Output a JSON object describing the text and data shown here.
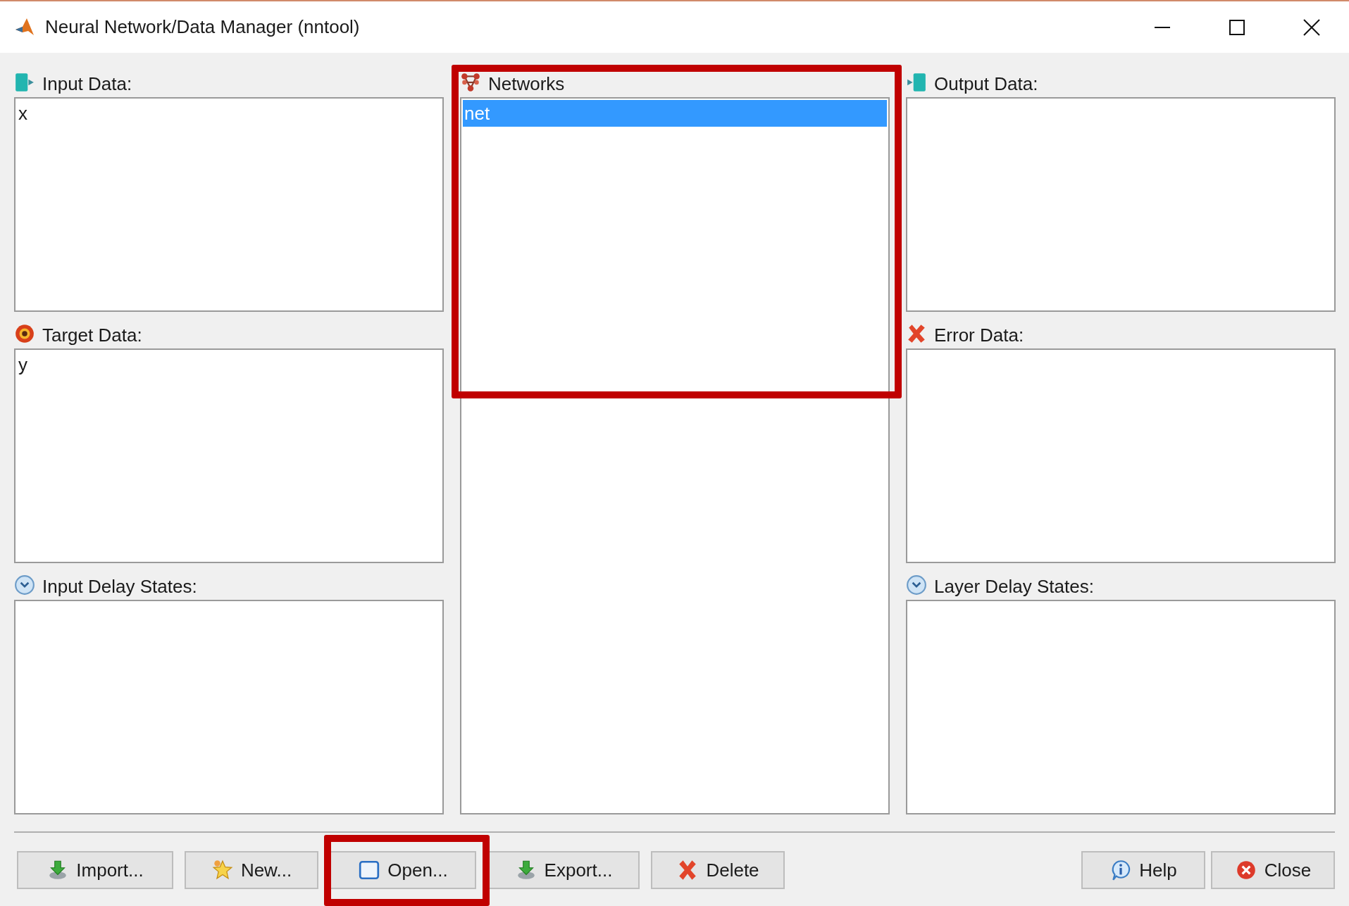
{
  "window": {
    "title": "Neural Network/Data Manager (nntool)"
  },
  "columns": [
    [
      {
        "label": "Input Data:",
        "items": [
          {
            "text": "x",
            "selected": false
          }
        ]
      },
      {
        "label": "Target Data:",
        "items": [
          {
            "text": "y",
            "selected": false
          }
        ]
      },
      {
        "label": "Input Delay States:"
      }
    ],
    [
      {
        "label": "Networks",
        "items": [
          {
            "text": "net",
            "selected": true
          }
        ]
      }
    ],
    [
      {
        "label": "Output Data:"
      },
      {
        "label": "Error Data:"
      },
      {
        "label": "Layer Delay States:"
      }
    ]
  ],
  "buttons": [
    {
      "label": "Import..."
    },
    {
      "label": "New..."
    },
    {
      "label": "Open..."
    },
    {
      "label": "Export..."
    },
    {
      "label": "Delete"
    },
    {
      "label": "Help"
    },
    {
      "label": "Close"
    }
  ]
}
